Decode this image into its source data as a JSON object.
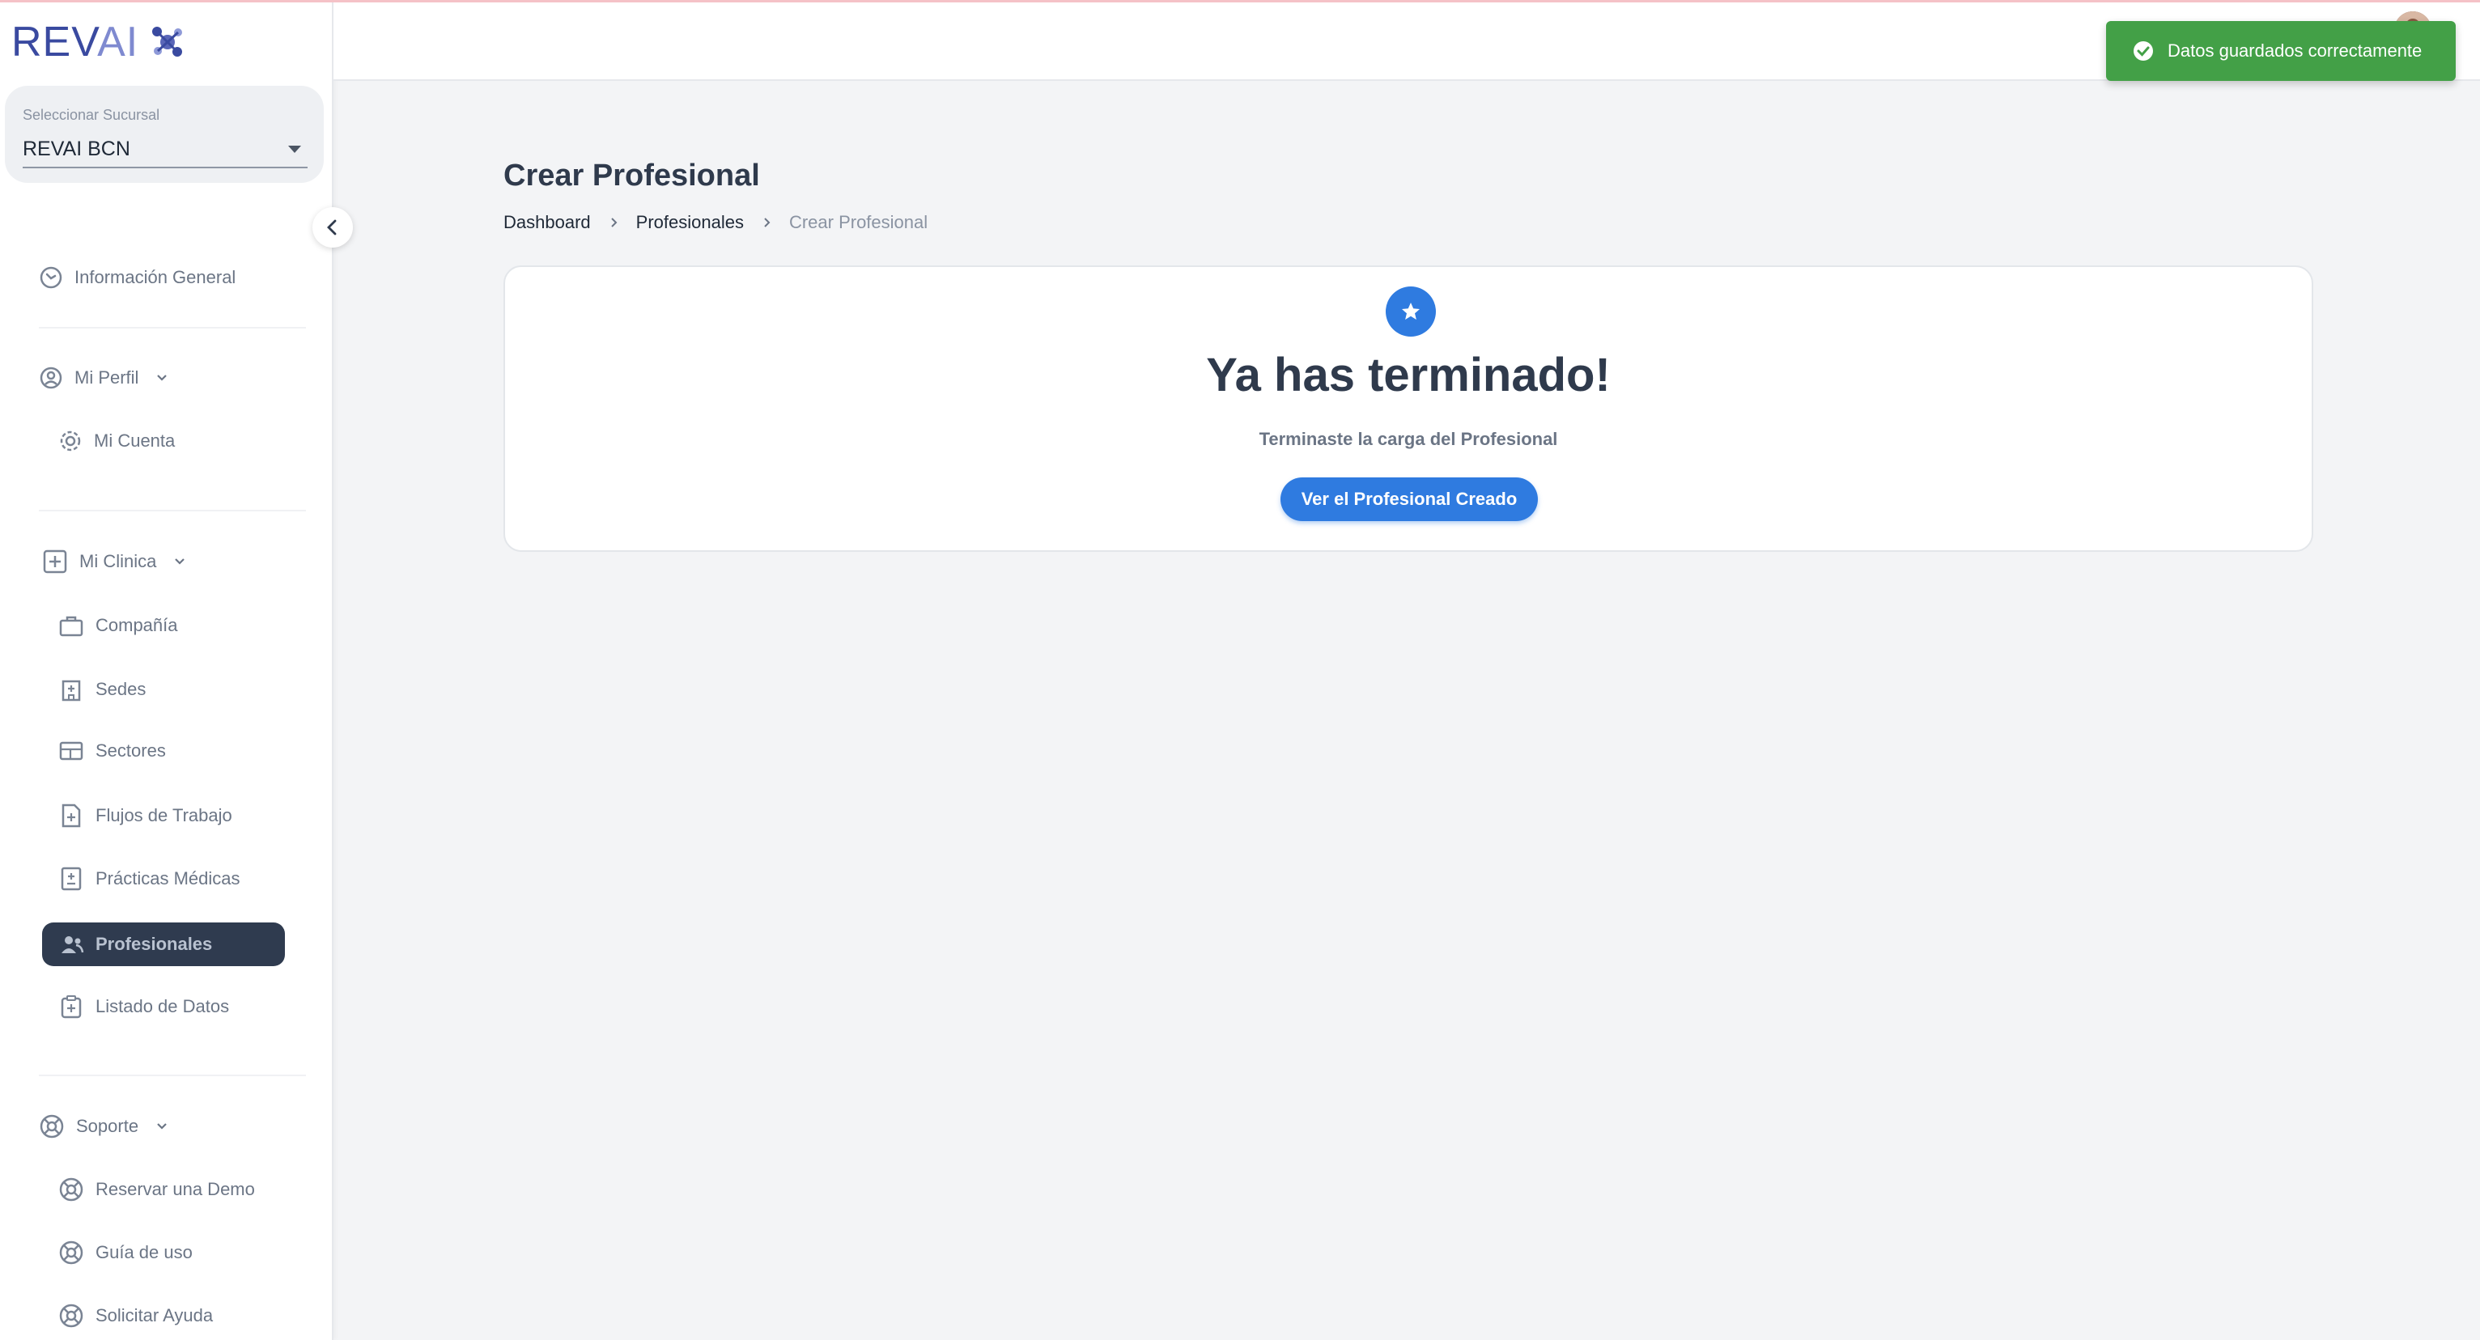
{
  "brand": {
    "logo_text_main": "REV",
    "logo_text_accent": "AI"
  },
  "branch": {
    "label": "Seleccionar Sucursal",
    "value": "REVAI BCN"
  },
  "sidebar": {
    "general": "Información General",
    "perfil": {
      "label": "Mi Perfil",
      "items": [
        "Mi Cuenta"
      ]
    },
    "clinica": {
      "label": "Mi Clinica",
      "items": [
        "Compañía",
        "Sedes",
        "Sectores",
        "Flujos de Trabajo",
        "Prácticas Médicas",
        "Profesionales",
        "Listado de Datos"
      ]
    },
    "soporte": {
      "label": "Soporte",
      "items": [
        "Reservar una Demo",
        "Guía de uso",
        "Solicitar Ayuda"
      ]
    },
    "active_item": "Profesionales"
  },
  "toast": {
    "message": "Datos guardados correctamente",
    "color": "#43a047"
  },
  "page": {
    "title": "Crear Profesional",
    "breadcrumb": [
      "Dashboard",
      "Profesionales",
      "Crear Profesional"
    ]
  },
  "card": {
    "title": "Ya has terminado!",
    "subtitle": "Terminaste la carga del Profesional",
    "button": "Ver el Profesional Creado",
    "accent": "#2f7be0"
  }
}
